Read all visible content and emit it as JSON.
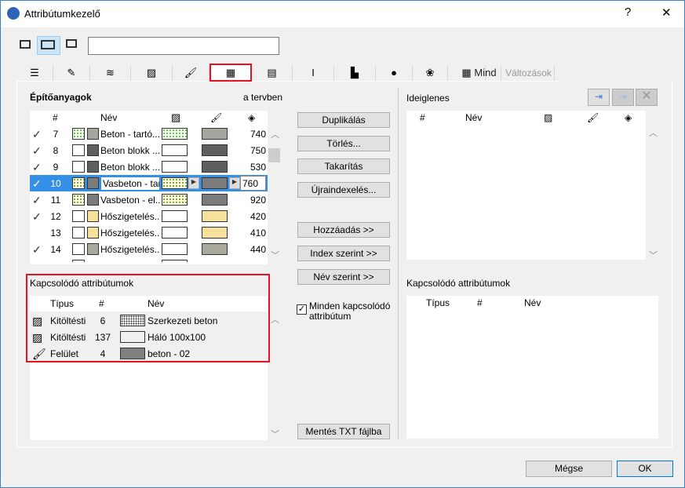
{
  "window": {
    "title": "Attribútumkezelő",
    "help": "?",
    "close": "✕"
  },
  "search": {
    "value": "",
    "placeholder": ""
  },
  "tabs": [
    "layers",
    "pen",
    "line",
    "fill",
    "surface",
    "building-material",
    "composite",
    "profile",
    "zone",
    "city",
    "mep",
    "grid"
  ],
  "tab_mind": "Mind",
  "tab_changes": "Változások",
  "left": {
    "title": "Építőanyagok",
    "in_plan": "a tervben",
    "headers": {
      "num": "#",
      "name": "Név"
    },
    "rows": [
      {
        "check": true,
        "num": "7",
        "name": "Beton - tartó...",
        "fill": "gdots",
        "surface": "#a6a69e",
        "value": "740"
      },
      {
        "check": true,
        "num": "8",
        "name": "Beton blokk ...",
        "fill": "cross",
        "surface": "#5f5f5f",
        "value": "750"
      },
      {
        "check": true,
        "num": "9",
        "name": "Beton blokk ...",
        "fill": "cross",
        "surface": "#5f5f5f",
        "value": "530"
      },
      {
        "check": true,
        "num": "10",
        "name": "Vasbeton - tar",
        "fill": "dots",
        "surface": "#7b7b7b",
        "value": "760",
        "selected": true
      },
      {
        "check": true,
        "num": "11",
        "name": "Vasbeton - el...",
        "fill": "dots",
        "surface": "#7b7b7b",
        "value": "920"
      },
      {
        "check": true,
        "num": "12",
        "name": "Hőszigetelés...",
        "fill": "ocross",
        "surface": "#f5e09c",
        "value": "420"
      },
      {
        "check": false,
        "num": "13",
        "name": "Hőszigetelés...",
        "fill": "ocross",
        "surface": "#f5e09c",
        "value": "410"
      },
      {
        "check": true,
        "num": "14",
        "name": "Hőszigetelés...",
        "fill": "ocross",
        "surface": "#a9a99c",
        "value": "440"
      }
    ]
  },
  "related": {
    "title": "Kapcsolódó attribútumok",
    "headers": {
      "type": "Típus",
      "num": "#",
      "name": "Név"
    },
    "rows": [
      {
        "icon": "fill-icon",
        "type": "Kitöltésti",
        "num": "6",
        "name": "Szerkezeti beton",
        "swatch": "dots"
      },
      {
        "icon": "fill-icon",
        "type": "Kitöltésti",
        "num": "137",
        "name": "Háló 100x100",
        "swatch": "grid"
      },
      {
        "icon": "surface-icon",
        "type": "Felület",
        "num": "4",
        "name": "beton - 02",
        "swatch": "gray"
      }
    ]
  },
  "middle": {
    "duplicate": "Duplikálás",
    "delete": "Törlés...",
    "purge": "Takarítás",
    "reindex": "Újraindexelés...",
    "add": "Hozzáadás >>",
    "by_index": "Index szerint >>",
    "by_name": "Név szerint >>",
    "all_related": "Minden kapcsolódó attribútum",
    "all_related_checked": true,
    "save_txt": "Mentés TXT fájlba"
  },
  "right": {
    "title": "Ideiglenes",
    "headers": {
      "num": "#",
      "name": "Név"
    },
    "related_title": "Kapcsolódó attribútumok",
    "related_headers": {
      "type": "Típus",
      "num": "#",
      "name": "Név"
    }
  },
  "footer": {
    "cancel": "Mégse",
    "ok": "OK"
  },
  "colors": {
    "selection": "#3390e6",
    "highlight": "#e81123"
  }
}
